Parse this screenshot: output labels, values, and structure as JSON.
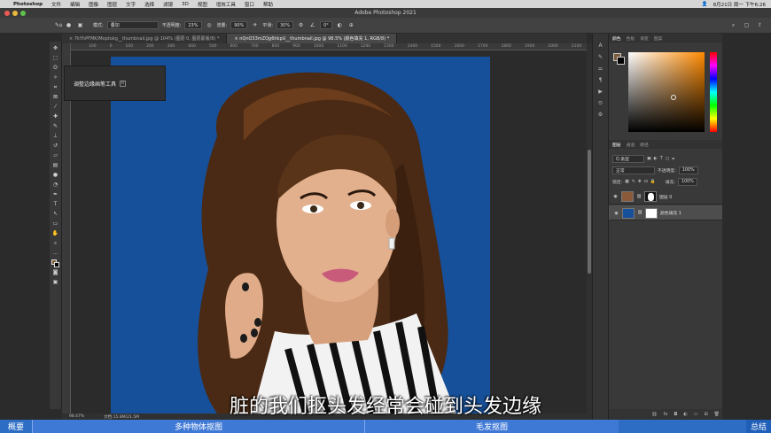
{
  "menubar": {
    "app": "Photoshop",
    "items": [
      "文件",
      "编辑",
      "图像",
      "图层",
      "文字",
      "选择",
      "滤镜",
      "3D",
      "视图",
      "增效工具",
      "窗口",
      "帮助"
    ],
    "clock": "8月21日 周一 下午6:26"
  },
  "window": {
    "title": "Adobe Photoshop 2021"
  },
  "options": {
    "mode_label": "模式:",
    "mode_value": "叠加",
    "opacity_label": "不透明度:",
    "opacity_value": "23%",
    "flow_label": "流量:",
    "flow_value": "90%",
    "smooth_label": "平滑:",
    "smooth_value": "30%",
    "angle_value": "0°"
  },
  "tabs": [
    {
      "label": "× 7kYhPFMK/Moptokg__thumbnail.jpg @ 104% (图层 0, 图层蒙版/8) *",
      "active": false
    },
    {
      "label": "× nQnO33mZQg6hkpU__thumbnail.jpg @ 98.5% (颜色填充 1, RGB/8) *",
      "active": true
    }
  ],
  "ruler_ticks": [
    "100",
    "0",
    "100",
    "200",
    "300",
    "400",
    "500",
    "600",
    "700",
    "800",
    "900",
    "1000",
    "1100",
    "1200",
    "1300",
    "1400",
    "1500",
    "1600",
    "1700",
    "1800",
    "1900",
    "2000",
    "2100"
  ],
  "tooltip": {
    "label": "调整边缘画笔工具",
    "key": "R"
  },
  "status": {
    "zoom": "98.47%",
    "doc": "文档:15.8M/21.5M"
  },
  "color_panel": {
    "tabs": [
      "颜色",
      "色板",
      "渐变",
      "图案"
    ],
    "fg_color": "#7a5a38",
    "bg_color": "#000000"
  },
  "layers_panel": {
    "tabs": [
      "图层",
      "通道",
      "路径"
    ],
    "filter_label": "Q 类型",
    "blend_mode": "正常",
    "opacity_label": "不透明度:",
    "opacity_value": "100%",
    "lock_label": "锁定:",
    "fill_label": "填充:",
    "fill_value": "100%",
    "layers": [
      {
        "name": "图层 0",
        "selected": false
      },
      {
        "name": "颜色填充 1",
        "selected": true
      }
    ]
  },
  "subtitle": "脏的我们抠头发经常会碰到头发边缘",
  "chapters": {
    "left": "概要",
    "seg1": "多种物体抠图",
    "seg2": "毛发抠图",
    "right": "总结"
  },
  "colors": {
    "canvas_bg": "#16509a",
    "chapter_bar": "#2d6ec4"
  }
}
